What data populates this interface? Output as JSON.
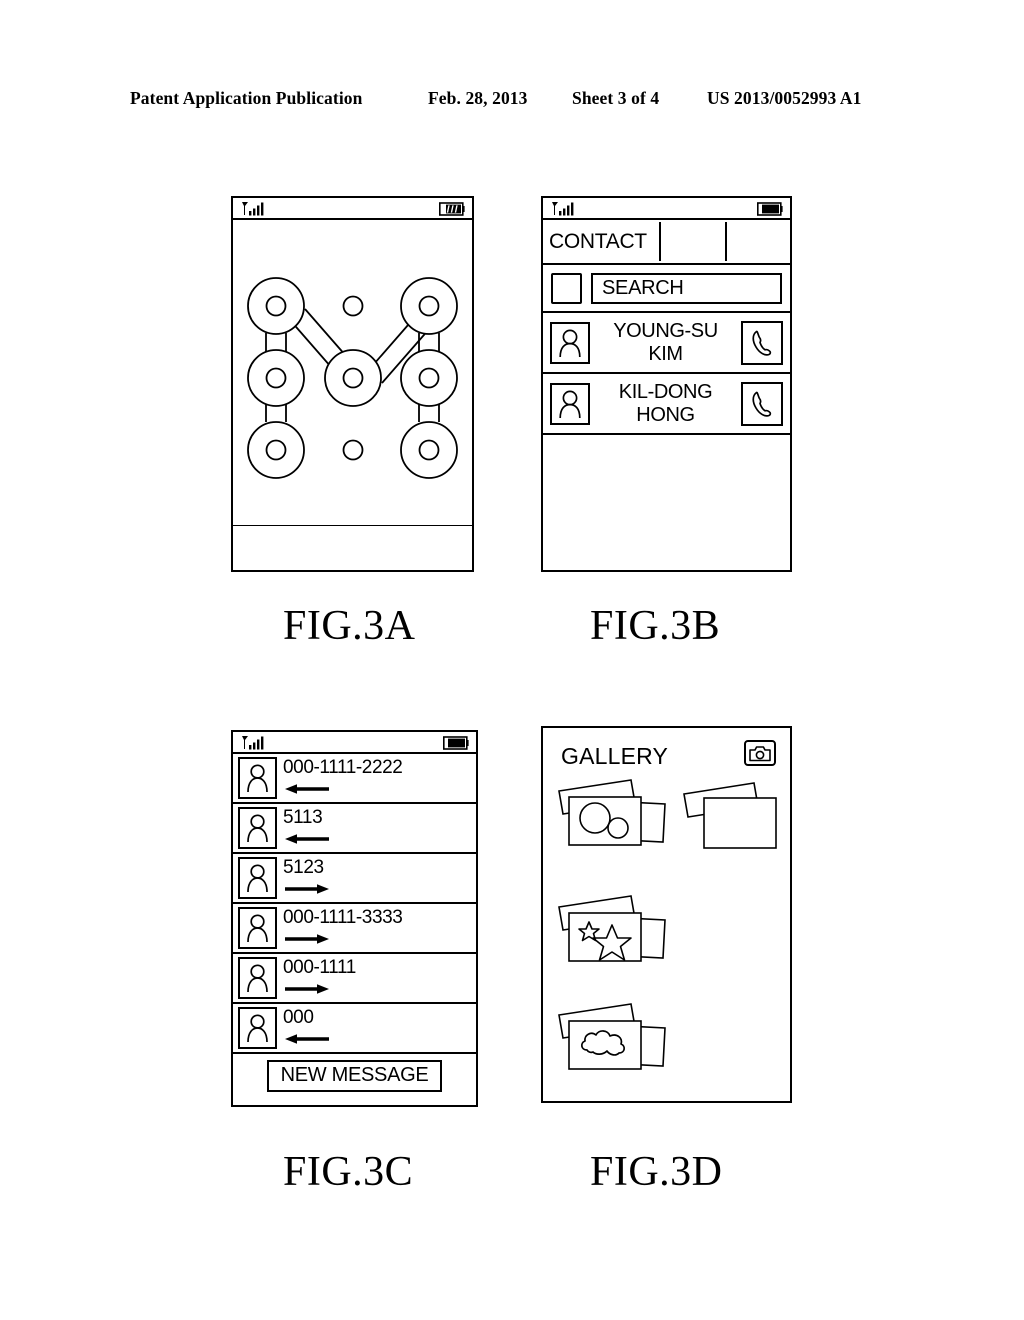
{
  "header": {
    "publication": "Patent Application Publication",
    "date": "Feb. 28, 2013",
    "sheet": "Sheet 3 of 4",
    "number": "US 2013/0052993 A1"
  },
  "captions": {
    "fig_a": "FIG.3A",
    "fig_b": "FIG.3B",
    "fig_c": "FIG.3C",
    "fig_d": "FIG.3D"
  },
  "status_bar": {
    "signal_icon": "signal-bars-icon",
    "battery_icon": "battery-icon"
  },
  "fig_a": {
    "title": "Pattern lock screen",
    "grid": {
      "rows": 3,
      "cols": 3,
      "selected_nodes": [
        0,
        1,
        2,
        3,
        5,
        6,
        7,
        8
      ],
      "unselected_nodes": [
        1
      ],
      "pattern_path": "bottom-left, mid-left, top-left, center, top-right, mid-right, bottom-right"
    }
  },
  "fig_b": {
    "tabs": [
      {
        "label": "CONTACT"
      },
      {
        "label": ""
      },
      {
        "label": ""
      }
    ],
    "search": {
      "checkbox_label": "",
      "value": "SEARCH",
      "placeholder": "SEARCH"
    },
    "contacts": [
      {
        "avatar_icon": "person-icon",
        "name": "YOUNG-SU KIM",
        "action_icon": "phone-handset-icon"
      },
      {
        "avatar_icon": "person-icon",
        "name": "KIL-DONG HONG",
        "action_icon": "phone-handset-icon"
      }
    ]
  },
  "fig_c": {
    "messages": [
      {
        "avatar_icon": "person-icon",
        "number": "000-1111-2222",
        "direction": "left"
      },
      {
        "avatar_icon": "person-icon",
        "number": "5113",
        "direction": "left"
      },
      {
        "avatar_icon": "person-icon",
        "number": "5123",
        "direction": "right"
      },
      {
        "avatar_icon": "person-icon",
        "number": "000-1111-3333",
        "direction": "right"
      },
      {
        "avatar_icon": "person-icon",
        "number": "000-1111",
        "direction": "right"
      },
      {
        "avatar_icon": "person-icon",
        "number": "000",
        "direction": "left"
      }
    ],
    "new_message_label": "NEW MESSAGE"
  },
  "fig_d": {
    "title": "GALLERY",
    "camera_icon": "camera-icon",
    "albums": [
      {
        "thumb": "circles",
        "cards": 3
      },
      {
        "thumb": "blank",
        "cards": 2
      },
      {
        "thumb": "stars",
        "cards": 3
      },
      {
        "thumb": "cloud",
        "cards": 3
      }
    ]
  },
  "colors": {
    "ink": "#000000",
    "paper": "#ffffff"
  }
}
